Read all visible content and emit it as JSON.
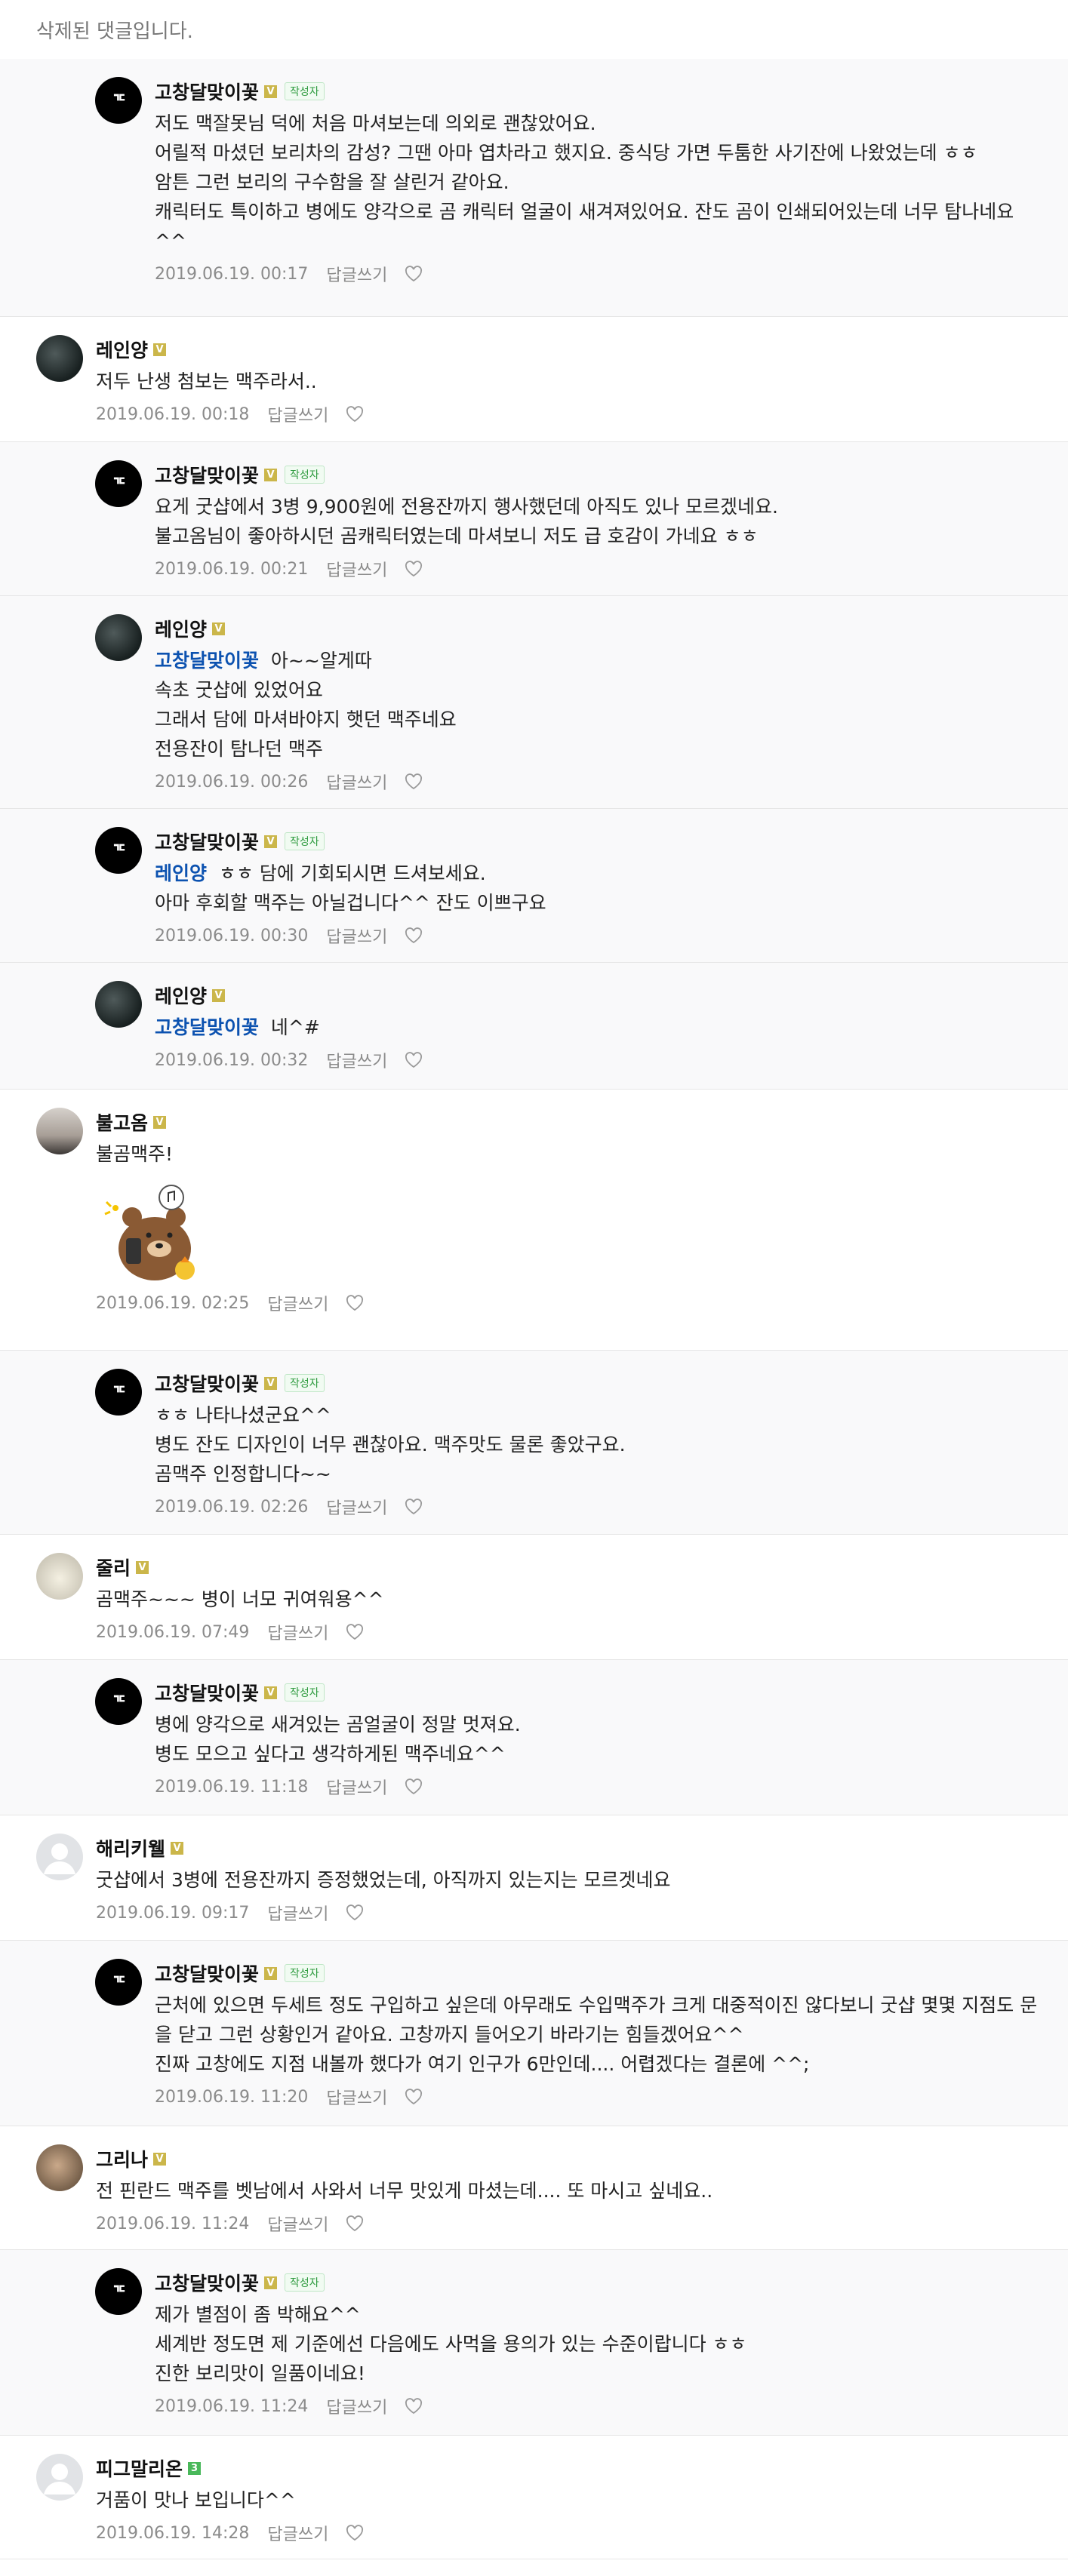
{
  "deleted_notice": "삭제된 댓글입니다.",
  "reply_label": "답글쓰기",
  "author_badge": "작성자",
  "comments": [
    {
      "nick": "고창달맞이꽃",
      "text": "저도 맥잘못님 덕에 처음 마셔보는데 의외로 괜찮았어요.\n어릴적 마셨던 보리차의 감성? 그땐 아마 엽차라고 했지요. 중식당 가면 두툼한 사기잔에 나왔었는데 ㅎㅎ\n암튼 그런 보리의 구수함을 잘 살린거 같아요.\n캐릭터도 특이하고 병에도 양각으로 곰 캐릭터 얼굴이 새겨져있어요. 잔도 곰이 인쇄되어있는데 너무 탐나네요^^",
      "date": "2019.06.19. 00:17"
    },
    {
      "nick": "레인양",
      "text": "저두 난생 첨보는 맥주라서..",
      "date": "2019.06.19. 00:18"
    },
    {
      "nick": "고창달맞이꽃",
      "text": "요게 굿샵에서 3병 9,900원에 전용잔까지 행사했던데 아직도 있나 모르겠네요.\n불고옴님이 좋아하시던 곰캐릭터였는데 마셔보니 저도 급 호감이 가네요 ㅎㅎ",
      "date": "2019.06.19. 00:21"
    },
    {
      "nick": "레인양",
      "mention": "고창달맞이꽃",
      "text": "아~~알게따\n속초 굿샵에 있었어요\n그래서 담에 마셔바야지 햇던 맥주네요\n전용잔이 탐나던 맥주",
      "date": "2019.06.19. 00:26"
    },
    {
      "nick": "고창달맞이꽃",
      "mention": "레인양",
      "text": "ㅎㅎ 담에 기회되시면 드셔보세요.\n아마 후회할 맥주는 아닐겁니다^^ 잔도 이쁘구요",
      "date": "2019.06.19. 00:30"
    },
    {
      "nick": "레인양",
      "mention": "고창달맞이꽃",
      "text": "네^#",
      "date": "2019.06.19. 00:32"
    },
    {
      "nick": "불고옴",
      "text": "불곰맥주!",
      "date": "2019.06.19. 02:25"
    },
    {
      "nick": "고창달맞이꽃",
      "text": "ㅎㅎ 나타나셨군요^^\n병도 잔도 디자인이 너무 괜찮아요. 맥주맛도 물론 좋았구요.\n곰맥주 인정합니다~~",
      "date": "2019.06.19. 02:26"
    },
    {
      "nick": "줄리",
      "text": "곰맥주~~~ 병이 너모 귀여워용^^",
      "date": "2019.06.19. 07:49"
    },
    {
      "nick": "고창달맞이꽃",
      "text": "병에 양각으로 새겨있는 곰얼굴이 정말 멋져요.\n병도 모으고 싶다고 생각하게된 맥주네요^^",
      "date": "2019.06.19. 11:18"
    },
    {
      "nick": "해리키웰",
      "text": "굿샵에서 3병에 전용잔까지 증정했었는데, 아직까지 있는지는 모르겟네요",
      "date": "2019.06.19. 09:17"
    },
    {
      "nick": "고창달맞이꽃",
      "text": "근처에 있으면 두세트 정도 구입하고 싶은데 아무래도 수입맥주가 크게 대중적이진 않다보니 굿샵 몇몇 지점도 문을 닫고 그런 상황인거 같아요. 고창까지 들어오기 바라기는 힘들겠어요^^\n진짜 고창에도 지점 내볼까 했다가 여기 인구가 6만인데.... 어렵겠다는 결론에 ^^;",
      "date": "2019.06.19. 11:20"
    },
    {
      "nick": "그리나",
      "text": "전 핀란드 맥주를 벳남에서 사와서 너무 맛있게 마셨는데.... 또 마시고 싶네요..",
      "date": "2019.06.19. 11:24"
    },
    {
      "nick": "고창달맞이꽃",
      "text": "제가 별점이 좀 박해요^^\n세계반 정도면 제 기준에선 다음에도 사먹을 용의가 있는 수준이랍니다 ㅎㅎ\n진한 보리맛이 일품이네요!",
      "date": "2019.06.19. 11:24"
    },
    {
      "nick": "피그말리온",
      "text": "거품이 맛나 보입니다^^",
      "date": "2019.06.19. 14:28"
    }
  ]
}
